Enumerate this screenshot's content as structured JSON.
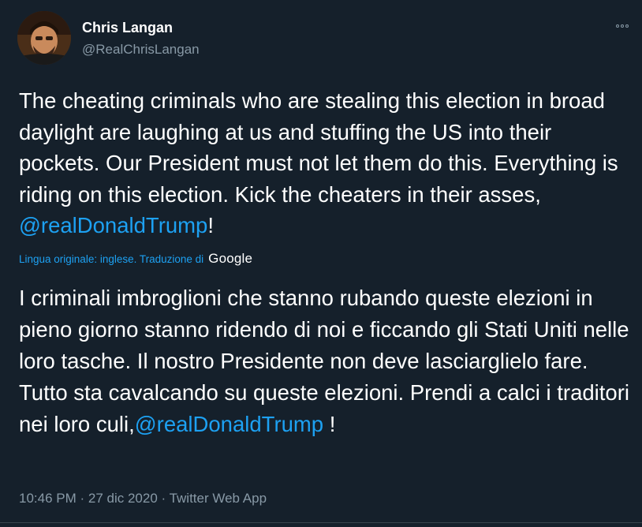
{
  "author": {
    "name": "Chris Langan",
    "handle": "@RealChrisLangan"
  },
  "tweet": {
    "text_parts": [
      "The cheating criminals who are stealing this election in broad daylight are laughing at us and stuffing the US into their pockets. Our President must not let them do this. Everything is riding on this election. Kick the cheaters in their asses, ",
      "@realDonaldTrump",
      "!"
    ]
  },
  "translation": {
    "meta_label": "Lingua originale: inglese. Traduzione di",
    "provider": "Google",
    "text_parts": [
      "I criminali imbroglioni che stanno rubando queste elezioni in pieno giorno stanno ridendo di noi e ficcando gli Stati Uniti nelle loro tasche. Il nostro Presidente non deve lasciarglielo fare. Tutto sta cavalcando su queste elezioni. Prendi a calci i traditori nei loro culi,",
      "@realDonaldTrump",
      " !"
    ]
  },
  "meta": {
    "timestamp": "10:46 PM · 27 dic 2020 · Twitter Web App"
  },
  "colors": {
    "background": "#15202b",
    "text": "#ffffff",
    "secondary": "#8899a6",
    "link": "#1da1f2"
  },
  "icons": {
    "more": "more-options-icon",
    "avatar": "profile-photo"
  }
}
